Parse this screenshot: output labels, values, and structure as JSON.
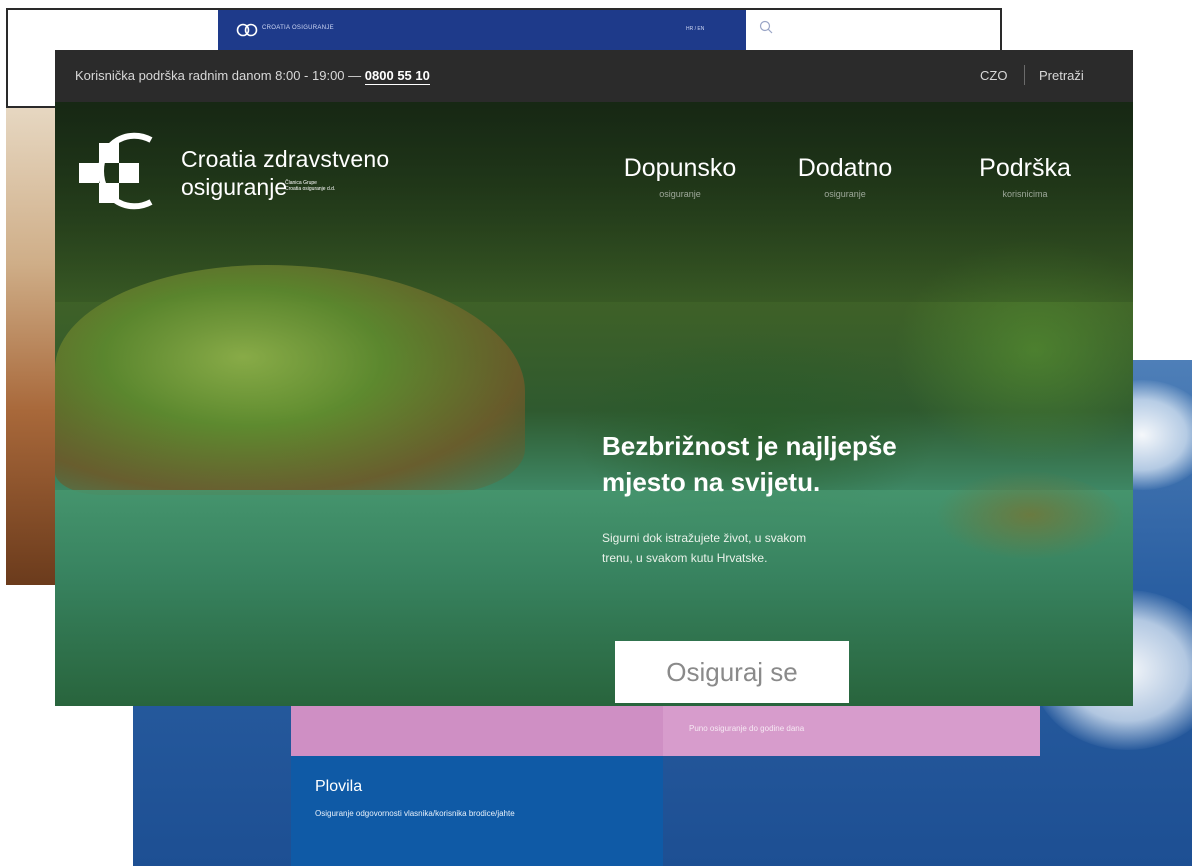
{
  "background_sky_card": {
    "banner_text": "Puno osiguranje do godine dana",
    "tile": {
      "title": "Plovila",
      "description": "Osiguranje odgovornosti vlasnika/korisnika brodice/jahte"
    }
  },
  "background_blue_header": {
    "brand": "CROATIA OSIGURANJE",
    "lang": "HR / EN"
  },
  "topbar": {
    "support_prefix": "Korisnička podrška radnim danom 8:00 - 19:00 —",
    "phone": "0800 55 10",
    "czo": "CZO",
    "search": "Pretraži"
  },
  "logo": {
    "line1": "Croatia zdravstveno",
    "line2": "osiguranje",
    "sub1": "Članica Grupe",
    "sub2": "Croatia osiguranje d.d."
  },
  "nav": [
    {
      "title": "Dopunsko",
      "sub": "osiguranje"
    },
    {
      "title": "Dodatno",
      "sub": "osiguranje"
    },
    {
      "title": "Podrška",
      "sub": "korisnicima"
    }
  ],
  "hero": {
    "headline_line1": "Bezbrižnost je najljepše",
    "headline_line2": "mjesto na svijetu.",
    "sub_line1": "Sigurni dok istražujete život, u svakom",
    "sub_line2": "trenu, u svakom kutu Hrvatske.",
    "cta": "Osiguraj se"
  },
  "colors": {
    "topbar_bg": "#2b2b2b",
    "blue_header": "#1e3a8a",
    "pink_band": "#d79ccc",
    "tile_blue": "#0f5aa6"
  }
}
